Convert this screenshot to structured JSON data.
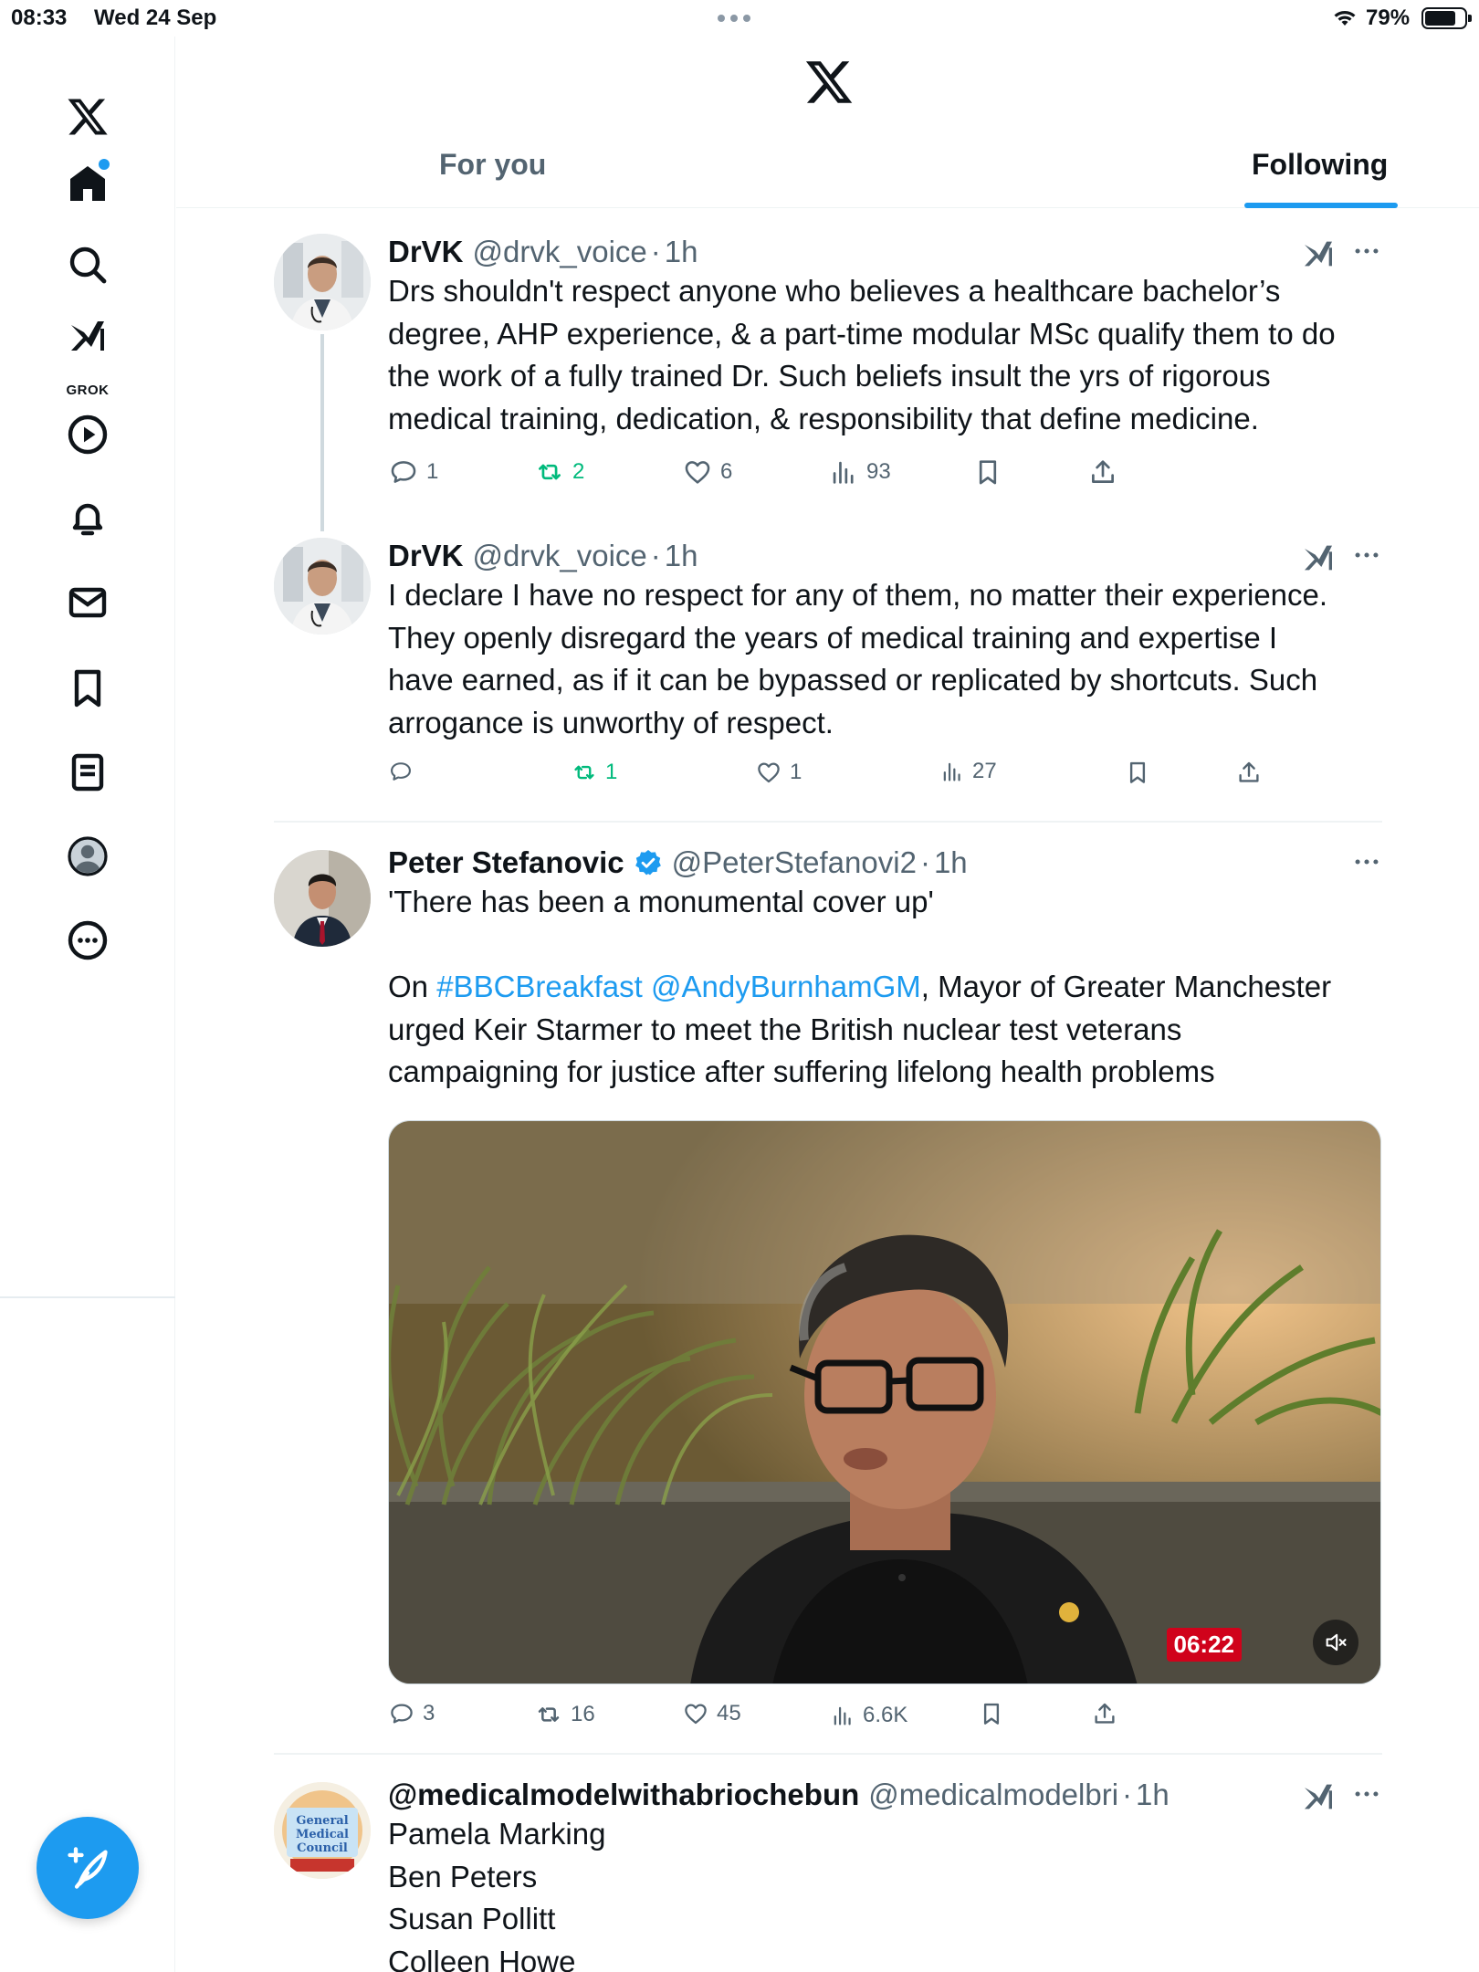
{
  "status_bar": {
    "time": "08:33",
    "date": "Wed 24 Sep",
    "battery_percent": "79%",
    "battery_level": 0.79
  },
  "sidebar": {
    "items": [
      {
        "id": "x-logo",
        "icon": "x-logo-icon"
      },
      {
        "id": "home",
        "icon": "home-icon",
        "has_notification_dot": true
      },
      {
        "id": "explore",
        "icon": "search-icon"
      },
      {
        "id": "grok",
        "icon": "grok-icon",
        "label": "GROK"
      },
      {
        "id": "video",
        "icon": "play-icon"
      },
      {
        "id": "notifications",
        "icon": "bell-icon"
      },
      {
        "id": "messages",
        "icon": "mail-icon"
      },
      {
        "id": "bookmarks",
        "icon": "bookmark-icon"
      },
      {
        "id": "lists",
        "icon": "list-icon"
      },
      {
        "id": "profile",
        "icon": "avatar-icon"
      },
      {
        "id": "more",
        "icon": "more-circle-icon"
      }
    ],
    "compose_icon": "compose-post-icon"
  },
  "tabs": [
    {
      "label": "For you",
      "selected": false
    },
    {
      "label": "Following",
      "selected": true
    }
  ],
  "colors": {
    "accent": "#1d9bf0",
    "text": "#0f1419",
    "secondary": "#536471",
    "retweet_active": "#00ba7c",
    "video_duration_bg": "#d0021b"
  },
  "posts": [
    {
      "name": "DrVK",
      "handle": "@drvk_voice",
      "sep": "·",
      "time": "1h",
      "verified": false,
      "text_lines": [
        "Drs shouldn't respect anyone who believes a healthcare bachelor’s",
        "degree, AHP experience, & a part-time modular MSc qualify them to do",
        "the work of a fully trained Dr. Such beliefs insult the yrs of rigorous",
        "medical training, dedication, & responsibility that define medicine."
      ],
      "replies": "1",
      "reposts": "2",
      "likes": "6",
      "views": "93"
    },
    {
      "name": "DrVK",
      "handle": "@drvk_voice",
      "sep": "·",
      "time": "1h",
      "verified": false,
      "text_lines": [
        "I declare I have no respect for any of them, no matter their experience.",
        "They openly disregard the years of medical training and expertise I",
        "have earned, as if it can be bypassed or replicated by shortcuts. Such",
        "arrogance is unworthy of respect."
      ],
      "replies": "",
      "reposts": "1",
      "likes": "1",
      "views": "27"
    },
    {
      "name": "Peter Stefanovic",
      "handle": "@PeterStefanovi2",
      "sep": "·",
      "time": "1h",
      "verified": true,
      "quote": "'There has been a monumental cover up'",
      "line_on": "On",
      "hashtag": "#BBCBreakfast",
      "mention": "@AndyBurnhamGM",
      "line_rest": ", Mayor of Greater Manchester",
      "text_lines_after": [
        "urged Keir Starmer to meet the British nuclear test veterans",
        "campaigning for justice after suffering lifelong health problems"
      ],
      "video": {
        "duration": "06:22",
        "muted": true
      },
      "replies": "3",
      "reposts": "16",
      "likes": "45",
      "views": "6.6K"
    },
    {
      "name": "@medicalmodelwithabriochebun",
      "handle": "@medicalmodelbri",
      "sep": "·",
      "time": "1h",
      "verified": false,
      "avatar_badge_lines": [
        "General",
        "Medical",
        "Council"
      ],
      "text_lines": [
        "Pamela Marking",
        "Ben Peters",
        "Susan Pollitt",
        "Colleen Howe"
      ]
    }
  ]
}
